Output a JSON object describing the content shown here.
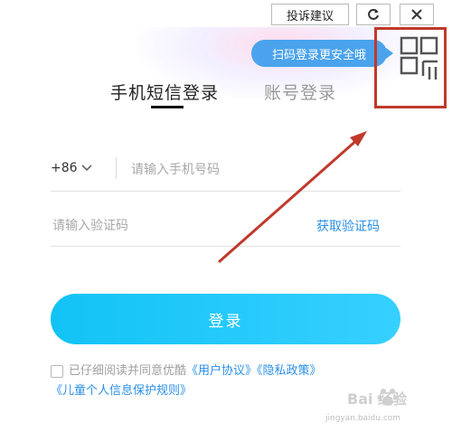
{
  "window": {
    "feedback_label": "投诉建议",
    "refresh_icon": "refresh-icon",
    "close_icon": "close-icon"
  },
  "qr": {
    "tooltip": "扫码登录更安全哦",
    "icon": "qr-code-icon",
    "highlight_color": "#c0392b"
  },
  "tabs": [
    {
      "label": "手机短信登录",
      "active": true
    },
    {
      "label": "账号登录",
      "active": false
    }
  ],
  "form": {
    "country_code": "+86",
    "phone_placeholder": "请输入手机号码",
    "code_placeholder": "请输入验证码",
    "get_code_label": "获取验证码",
    "login_label": "登录"
  },
  "agreement": {
    "prefix": "已仔细阅读并同意优酷",
    "user_agreement": "《用户协议》",
    "privacy_policy": "《隐私政策》",
    "child_policy": "《儿童个人信息保护规则》"
  },
  "watermark": {
    "main": "Bai 经验",
    "sub": "jingyan.baidu.com"
  },
  "colors": {
    "accent": "#2a8fe6",
    "login_button": "#12c3f5",
    "tooltip": "#4aa3ec",
    "annotation": "#c0392b"
  }
}
